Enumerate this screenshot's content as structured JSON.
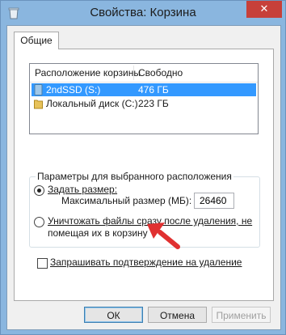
{
  "window": {
    "title": "Свойства: Корзина",
    "close_glyph": "✕"
  },
  "tabs": [
    {
      "label": "Общие"
    }
  ],
  "listview": {
    "headers": [
      "Расположение корзины",
      "Свободно"
    ],
    "rows": [
      {
        "name": "2ndSSD (S:)",
        "free": "476 ГБ",
        "selected": true
      },
      {
        "name": "Локальный диск (C:)",
        "free": "223 ГБ",
        "selected": false
      }
    ]
  },
  "settings": {
    "group_title": "Параметры для выбранного расположения",
    "radio_custom": "Задать размер:",
    "max_size_label": "Максимальный размер (МБ):",
    "max_size_value": "26460",
    "radio_delete_line1": "Уничтожать файлы сразу после удаления, не",
    "radio_delete_line2": "помещая их в корзину",
    "confirm_delete": "Запрашивать подтверждение на удаление",
    "selected_option": "custom-size",
    "confirm_checked": false
  },
  "buttons": {
    "ok": "ОК",
    "cancel": "Отмена",
    "apply": "Применить"
  },
  "colors": {
    "selection": "#3399ff",
    "close": "#c7403a",
    "arrow": "#e03030"
  },
  "icons": [
    "recycle-bin-icon",
    "drive-icon",
    "close-icon",
    "annotation-arrow-icon"
  ]
}
